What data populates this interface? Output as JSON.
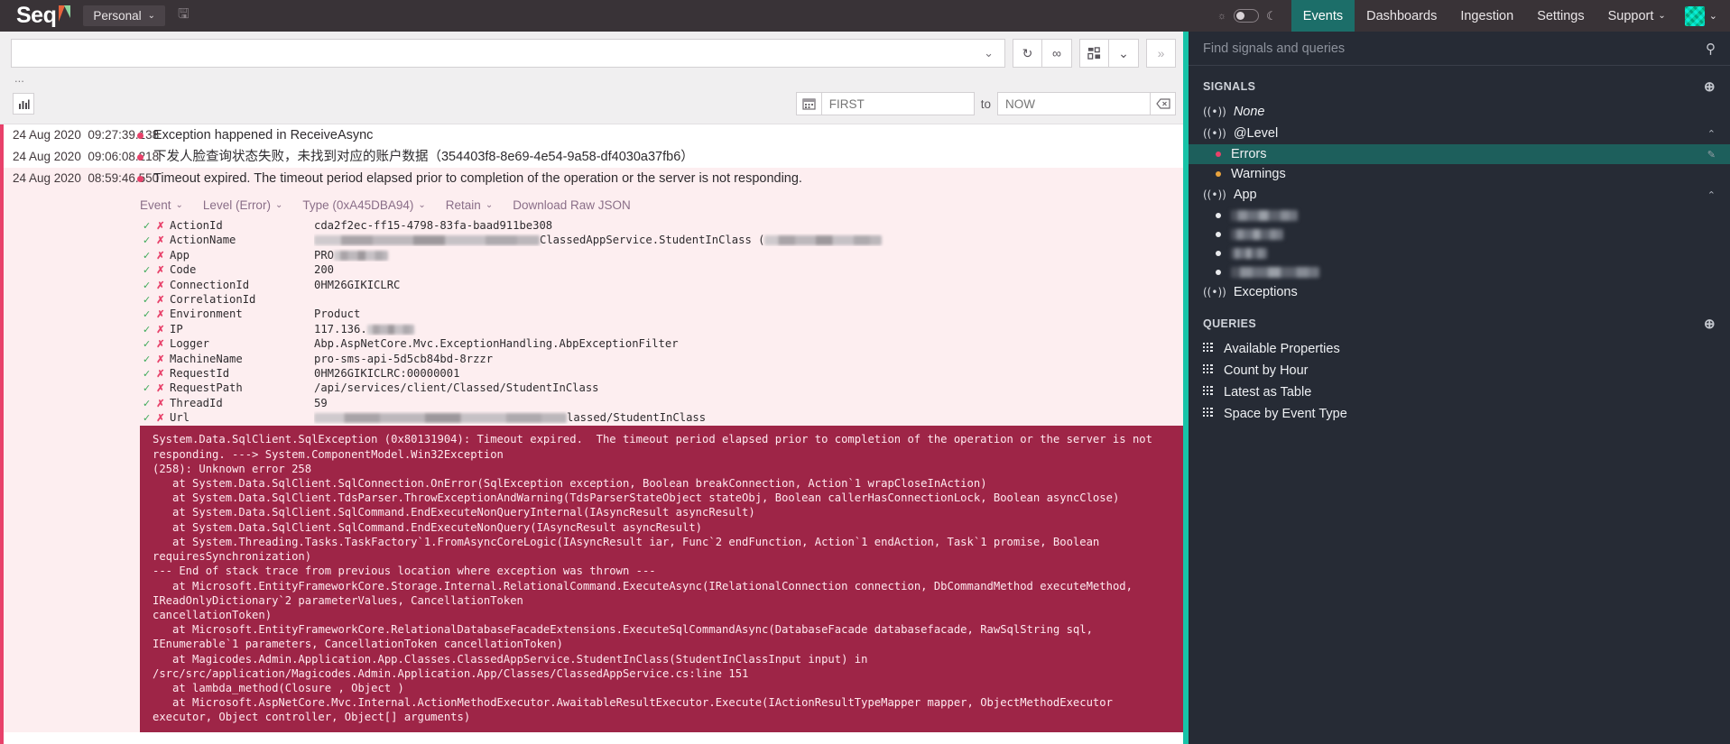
{
  "colors": {
    "nav_bg": "#393337",
    "accent_teal": "#17c3a8",
    "active_nav": "#1c6e69",
    "error_pink": "#e8416a",
    "exception_bg": "#9e2547",
    "sidebar_bg": "#262b35",
    "sidebar_active": "#1d5f5c",
    "detail_bg": "#fdeef0",
    "warning_amber": "#e8a33d"
  },
  "topnav": {
    "brand": "Seq",
    "brand_flag_icon": "flag-icon",
    "workspace": "Personal",
    "workspace_chevron_icon": "chevron-down-icon",
    "save_icon": "save-icon",
    "theme": {
      "sun_icon": "sun-icon",
      "toggle_icon": "theme-toggle-switch",
      "moon_icon": "moon-icon"
    },
    "items": [
      {
        "label": "Events",
        "active": true
      },
      {
        "label": "Dashboards",
        "active": false
      },
      {
        "label": "Ingestion",
        "active": false
      },
      {
        "label": "Settings",
        "active": false
      },
      {
        "label": "Support",
        "active": false,
        "chevron": "⌄"
      }
    ],
    "avatar_icon": "avatar",
    "avatar_chevron_icon": "chevron-down-icon"
  },
  "querybar": {
    "query_value": "",
    "query_placeholder": "",
    "history_chevron_icon": "chevron-down-icon",
    "refresh_icon": "refresh-icon",
    "link_icon": "infinity-icon",
    "layout_icon": "grid-icon",
    "layout_chevron_icon": "chevron-down-icon",
    "expand_icon": "double-chevron-right-icon",
    "ellipsis": "..."
  },
  "timebar": {
    "chart_icon": "bar-chart-icon",
    "calendar_icon": "calendar-icon",
    "from_value": "",
    "from_placeholder": "FIRST",
    "to_label": "to",
    "to_value": "",
    "to_placeholder": "NOW",
    "clear_icon": "clear-range-icon"
  },
  "events": [
    {
      "date": "24 Aug 2020",
      "time": "09:27:39.138",
      "level": "error",
      "message": "Exception happened in ReceiveAsync",
      "selected": false
    },
    {
      "date": "24 Aug 2020",
      "time": "09:06:08.218",
      "level": "error",
      "message": "下发人脸查询状态失败，未找到对应的账户数据（354403f8-8e69-4e54-9a58-df4030a37fb6）",
      "selected": false
    },
    {
      "date": "24 Aug 2020",
      "time": "08:59:46.550",
      "level": "error",
      "message": "Timeout expired. The timeout period elapsed prior to completion of the operation or the server is not responding.",
      "selected": true
    }
  ],
  "detail": {
    "actions": [
      {
        "label": "Event",
        "chevron": "⌄"
      },
      {
        "label": "Level (Error)",
        "chevron": "⌄"
      },
      {
        "label": "Type (0xA45DBA94)",
        "chevron": "⌄"
      },
      {
        "label": "Retain",
        "chevron": "⌄"
      },
      {
        "label": "Download Raw JSON",
        "chevron": ""
      }
    ],
    "include_icon": "check-icon",
    "exclude_icon": "cross-icon",
    "properties": [
      {
        "name": "ActionId",
        "value": "cda2f2ec-ff15-4798-83fa-baad911be308",
        "redacted": false
      },
      {
        "name": "ActionName",
        "value": "",
        "redacted": true,
        "redact_width": 250,
        "suffix": "ClassedAppService.StudentInClass (",
        "suffix_redact_width": 130
      },
      {
        "name": "App",
        "value": "PRO",
        "redacted": true,
        "redact_width": 60
      },
      {
        "name": "Code",
        "value": "200",
        "redacted": false
      },
      {
        "name": "ConnectionId",
        "value": "0HM26GIKICLRC",
        "redacted": false
      },
      {
        "name": "CorrelationId",
        "value": "",
        "redacted": false
      },
      {
        "name": "Environment",
        "value": "Product",
        "redacted": false
      },
      {
        "name": "IP",
        "value": "117.136.",
        "redacted": true,
        "redact_width": 52
      },
      {
        "name": "Logger",
        "value": "Abp.AspNetCore.Mvc.ExceptionHandling.AbpExceptionFilter",
        "redacted": false
      },
      {
        "name": "MachineName",
        "value": "pro-sms-api-5d5cb84bd-8rzzr",
        "redacted": false
      },
      {
        "name": "RequestId",
        "value": "0HM26GIKICLRC:00000001",
        "redacted": false
      },
      {
        "name": "RequestPath",
        "value": "/api/services/client/Classed/StudentInClass",
        "redacted": false
      },
      {
        "name": "ThreadId",
        "value": "59",
        "redacted": false
      },
      {
        "name": "Url",
        "value": "",
        "redacted": true,
        "redact_width": 280,
        "suffix": "lassed/StudentInClass",
        "suffix_redact_width": 0
      }
    ],
    "exception": "System.Data.SqlClient.SqlException (0x80131904): Timeout expired.  The timeout period elapsed prior to completion of the operation or the server is not responding. ---> System.ComponentModel.Win32Exception\n(258): Unknown error 258\n   at System.Data.SqlClient.SqlConnection.OnError(SqlException exception, Boolean breakConnection, Action`1 wrapCloseInAction)\n   at System.Data.SqlClient.TdsParser.ThrowExceptionAndWarning(TdsParserStateObject stateObj, Boolean callerHasConnectionLock, Boolean asyncClose)\n   at System.Data.SqlClient.SqlCommand.EndExecuteNonQueryInternal(IAsyncResult asyncResult)\n   at System.Data.SqlClient.SqlCommand.EndExecuteNonQuery(IAsyncResult asyncResult)\n   at System.Threading.Tasks.TaskFactory`1.FromAsyncCoreLogic(IAsyncResult iar, Func`2 endFunction, Action`1 endAction, Task`1 promise, Boolean requiresSynchronization)\n--- End of stack trace from previous location where exception was thrown ---\n   at Microsoft.EntityFrameworkCore.Storage.Internal.RelationalCommand.ExecuteAsync(IRelationalConnection connection, DbCommandMethod executeMethod, IReadOnlyDictionary`2 parameterValues, CancellationToken\ncancellationToken)\n   at Microsoft.EntityFrameworkCore.RelationalDatabaseFacadeExtensions.ExecuteSqlCommandAsync(DatabaseFacade databasefacade, RawSqlString sql, IEnumerable`1 parameters, CancellationToken cancellationToken)\n   at Magicodes.Admin.Application.App.Classes.ClassedAppService.StudentInClass(StudentInClassInput input) in /src/src/application/Magicodes.Admin.Application.App/Classes/ClassedAppService.cs:line 151\n   at lambda_method(Closure , Object )\n   at Microsoft.AspNetCore.Mvc.Internal.ActionMethodExecutor.AwaitableResultExecutor.Execute(IActionResultTypeMapper mapper, ObjectMethodExecutor executor, Object controller, Object[] arguments)"
  },
  "sidebar": {
    "search_placeholder": "Find signals and queries",
    "search_value": "",
    "search_icon": "search-icon",
    "signals_heading": "SIGNALS",
    "signals_add_icon": "plus-circle-icon",
    "signal_icon": "signal-icon",
    "signals": [
      {
        "type": "group",
        "label": "None",
        "italic": true,
        "caret": ""
      },
      {
        "type": "group",
        "label": "@Level",
        "italic": false,
        "caret": "⌃"
      },
      {
        "type": "item",
        "label": "Errors",
        "dot_color": "#e8416a",
        "active": true,
        "pencil": true
      },
      {
        "type": "item",
        "label": "Warnings",
        "dot_color": "#e8a33d",
        "active": false,
        "pencil": false
      },
      {
        "type": "group",
        "label": "App",
        "italic": false,
        "caret": "⌃"
      },
      {
        "type": "item",
        "label": "",
        "dot_color": "#e9ebee",
        "active": false,
        "redacted": true,
        "redact_width": 74
      },
      {
        "type": "item",
        "label": "",
        "dot_color": "#e9ebee",
        "active": false,
        "redacted": true,
        "redact_width": 58
      },
      {
        "type": "item",
        "label": "",
        "dot_color": "#e9ebee",
        "active": false,
        "redacted": true,
        "redact_width": 40
      },
      {
        "type": "item",
        "label": "",
        "dot_color": "#e9ebee",
        "active": false,
        "redacted": true,
        "redact_width": 98
      },
      {
        "type": "group",
        "label": "Exceptions",
        "italic": false,
        "caret": ""
      }
    ],
    "queries_heading": "QUERIES",
    "queries_add_icon": "plus-circle-icon",
    "query_icon": "query-grid-icon",
    "queries": [
      {
        "label": "Available Properties"
      },
      {
        "label": "Count by Hour"
      },
      {
        "label": "Latest as Table"
      },
      {
        "label": "Space by Event Type"
      }
    ]
  }
}
